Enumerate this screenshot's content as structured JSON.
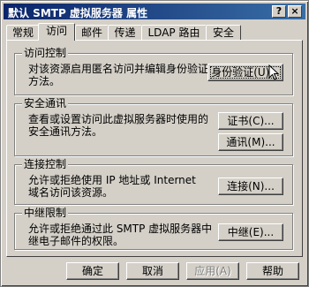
{
  "window": {
    "title": "默认 SMTP 虚拟服务器 属性",
    "help_button": "?",
    "close_button": "×"
  },
  "tabs": [
    {
      "label": "常规",
      "active": false
    },
    {
      "label": "访问",
      "active": true
    },
    {
      "label": "邮件",
      "active": false
    },
    {
      "label": "传递",
      "active": false
    },
    {
      "label": "LDAP 路由",
      "active": false
    },
    {
      "label": "安全",
      "active": false
    }
  ],
  "groups": {
    "access_control": {
      "title": "访问控制",
      "desc_line1": "对该资源启用匿名访问并编辑身份验证",
      "desc_line2": "方法。",
      "button": "身份验证(U)..."
    },
    "secure_communication": {
      "title": "安全通讯",
      "desc_line1": "查看或设置访问此虚拟服务器时使用的",
      "desc_line2": "安全通讯方法。",
      "button1": "证书(C)...",
      "button2": "通讯(M)..."
    },
    "connection_control": {
      "title": "连接控制",
      "desc_line1": "允许或拒绝使用 IP 地址或 Internet",
      "desc_line2": "域名访问该资源。",
      "button": "连接(N)..."
    },
    "relay_restrictions": {
      "title": "中继限制",
      "desc_line1": "允许或拒绝通过此 SMTP 虚拟服务器中",
      "desc_line2": "继电子邮件的权限。",
      "button": "中继(E)..."
    }
  },
  "footer": {
    "ok": "确定",
    "cancel": "取消",
    "apply": "应用(A)",
    "help": "帮助"
  }
}
